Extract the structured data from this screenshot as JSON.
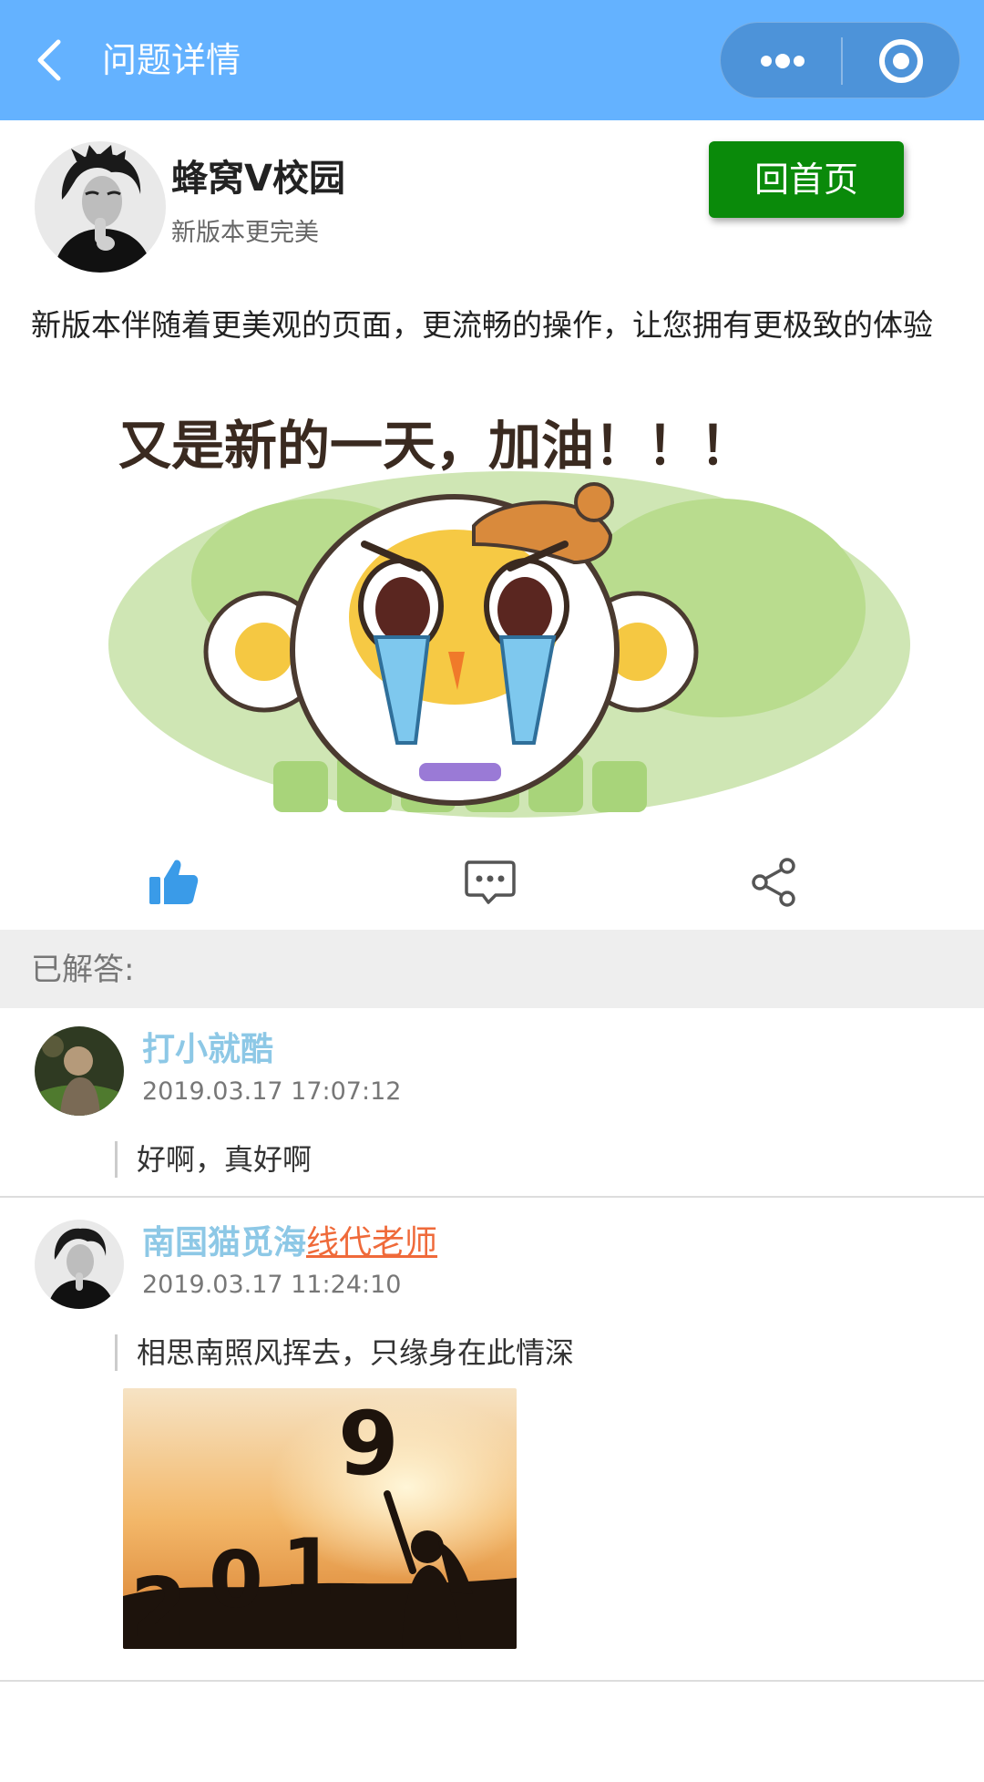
{
  "navbar": {
    "title": "问题详情",
    "background": "#64b2ff",
    "back_icon": "chevron-left-icon",
    "more_icon": "more-dots-icon",
    "close_icon": "target-circle-icon"
  },
  "author": {
    "name": "蜂窝V校园",
    "subtitle": "新版本更完美",
    "home_button": "回首页",
    "home_button_color": "#0a8a0a"
  },
  "post": {
    "text": "新版本伴随着更美观的页面，更流畅的操作，让您拥有更极致的体验",
    "image_caption": "又是新的一天，加油！！！"
  },
  "actions": [
    {
      "icon": "thumbs-up-icon",
      "color": "#3a9be8"
    },
    {
      "icon": "comment-icon",
      "color": "#555555"
    },
    {
      "icon": "share-icon",
      "color": "#555555"
    }
  ],
  "answers_section": {
    "label": "已解答:"
  },
  "answers": [
    {
      "name": "打小就酷",
      "role": "",
      "time": "2019.03.17 17:07:12",
      "text": "好啊，真好啊"
    },
    {
      "name": "南国猫觅海",
      "role": "线代老师",
      "time": "2019.03.17 11:24:10",
      "text": "相思南照风挥去，只缘身在此情深",
      "image_text_1": "2",
      "image_text_2": "0",
      "image_text_3": "1",
      "image_text_4": "9"
    }
  ],
  "colors": {
    "name_color": "#8dc8e6",
    "role_color": "#ef6a3a",
    "section_bg": "#eeeeee"
  }
}
